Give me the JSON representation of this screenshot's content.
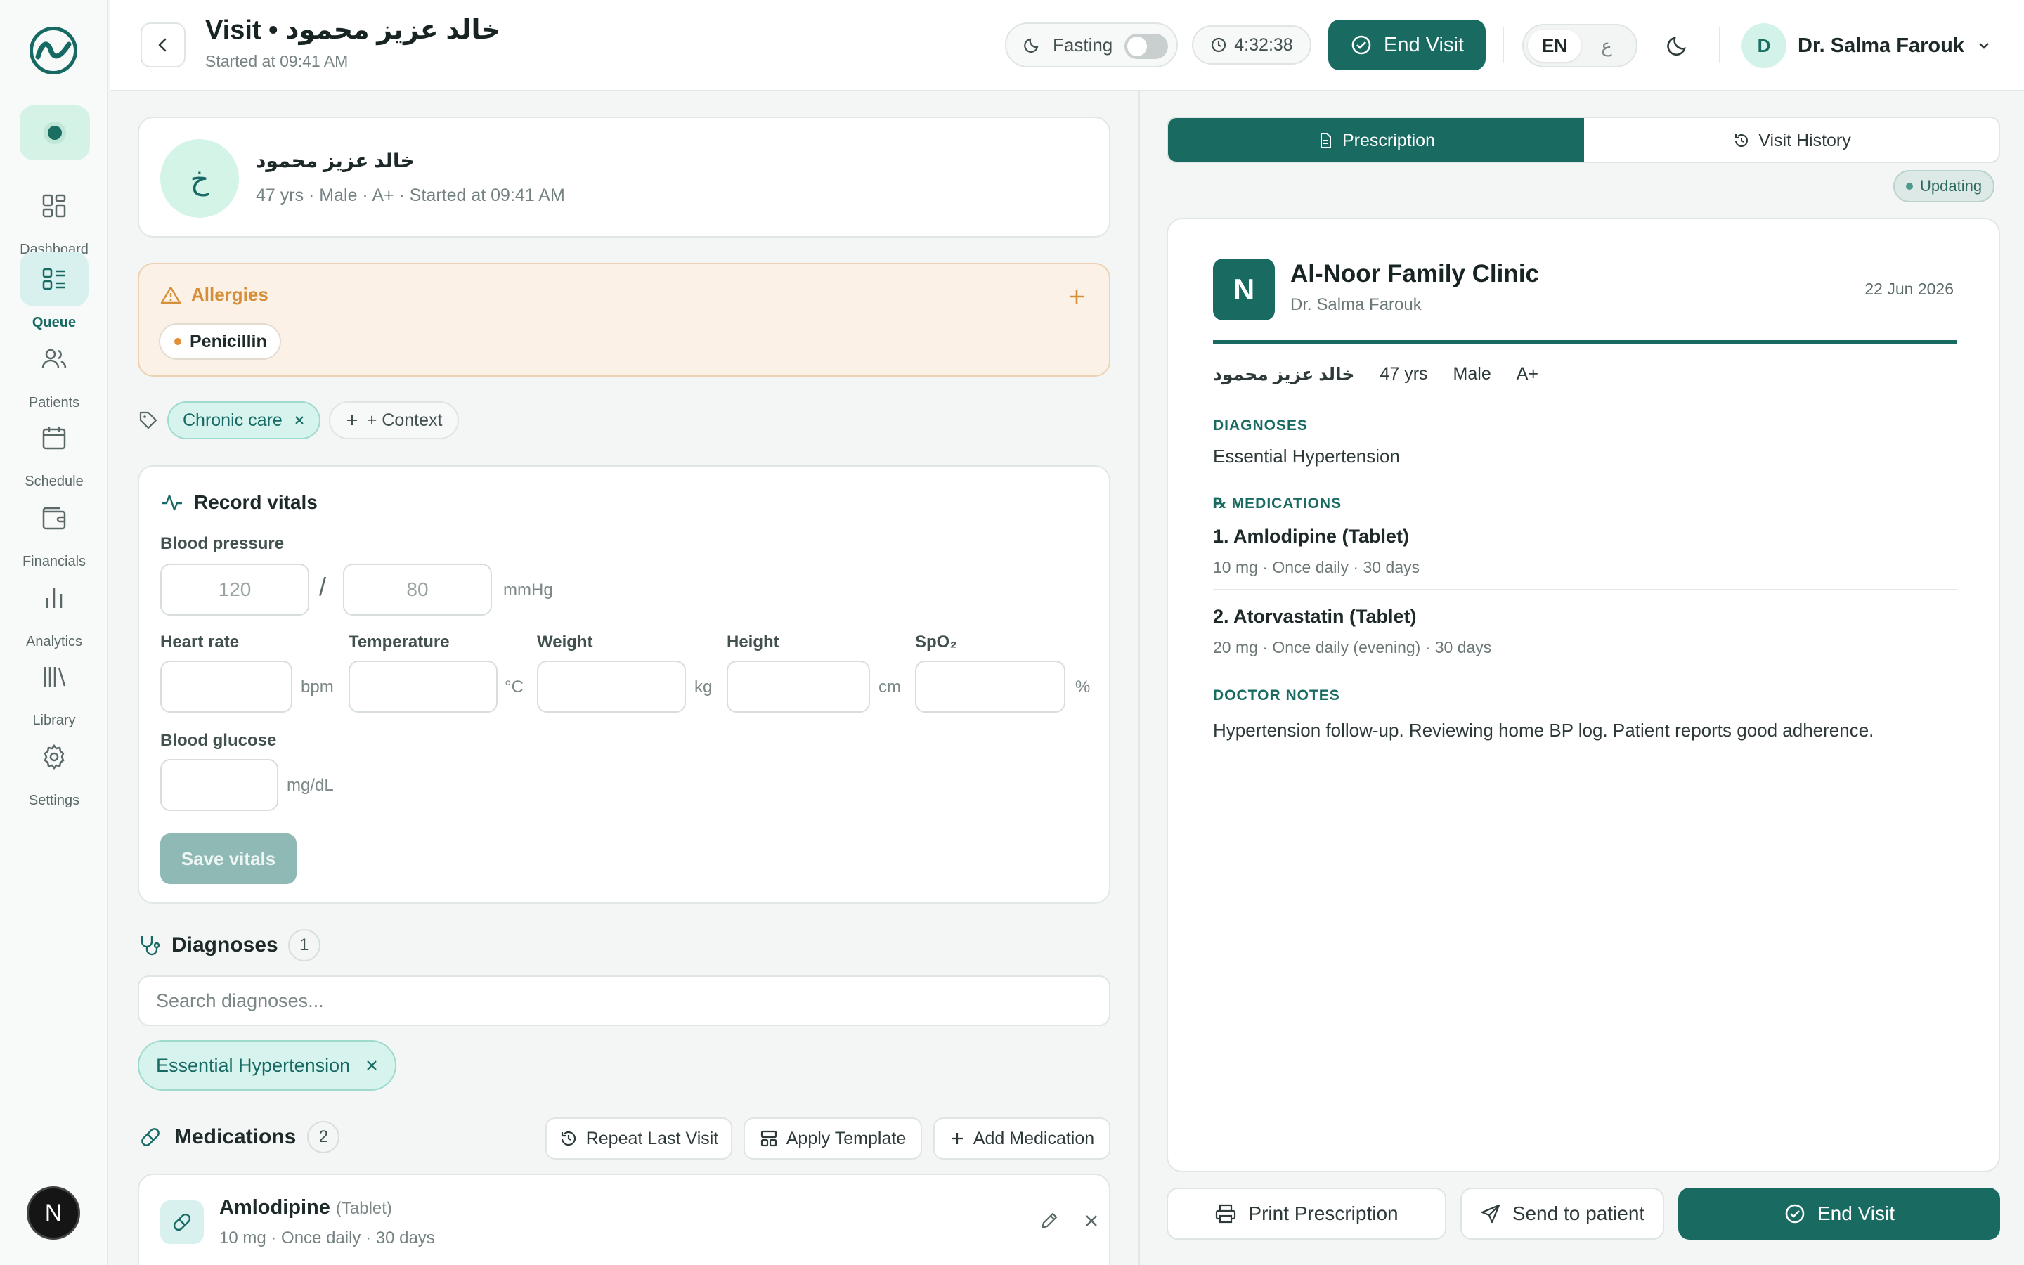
{
  "header": {
    "title": "Visit • خالد عزيز محمود",
    "subtitle": "Started at 09:41 AM",
    "fasting_label": "Fasting",
    "timer": "4:32:38",
    "end_visit_label": "End Visit",
    "lang_en": "EN",
    "lang_ar": "ع",
    "user_initial": "D",
    "user_name": "Dr. Salma Farouk"
  },
  "sidebar": {
    "logo_initial": "N",
    "items": [
      {
        "label": "Dashboard",
        "icon": "grid-icon"
      },
      {
        "label": "Queue",
        "icon": "list-icon",
        "active": true
      },
      {
        "label": "Patients",
        "icon": "users-icon"
      },
      {
        "label": "Schedule",
        "icon": "calendar-icon"
      },
      {
        "label": "Financials",
        "icon": "wallet-icon"
      },
      {
        "label": "Analytics",
        "icon": "bar-chart-icon"
      },
      {
        "label": "Library",
        "icon": "library-icon"
      },
      {
        "label": "Settings",
        "icon": "gear-icon"
      }
    ]
  },
  "patient": {
    "initial": "خ",
    "name": "خالد عزيز محمود",
    "meta": "47 yrs · Male · A+ · Started at 09:41 AM"
  },
  "allergies": {
    "title": "Allergies",
    "items": [
      "Penicillin"
    ]
  },
  "context": {
    "tags": [
      "Chronic care"
    ],
    "add_label": "+ Context"
  },
  "vitals": {
    "title": "Record vitals",
    "bp_label": "Blood pressure",
    "bp_sys_placeholder": "120",
    "bp_dia_placeholder": "80",
    "bp_sep": "/",
    "bp_unit": "mmHg",
    "fields": [
      {
        "label": "Heart rate",
        "unit": "bpm"
      },
      {
        "label": "Temperature",
        "unit": "°C"
      },
      {
        "label": "Weight",
        "unit": "kg"
      },
      {
        "label": "Height",
        "unit": "cm"
      },
      {
        "label": "SpO₂",
        "unit": "%"
      }
    ],
    "glucose_label": "Blood glucose",
    "glucose_unit": "mg/dL",
    "save_label": "Save vitals"
  },
  "diagnoses": {
    "title": "Diagnoses",
    "count": "1",
    "search_placeholder": "Search diagnoses...",
    "items": [
      "Essential Hypertension"
    ]
  },
  "medications": {
    "title": "Medications",
    "count": "2",
    "repeat_label": "Repeat Last Visit",
    "template_label": "Apply Template",
    "add_label": "Add Medication",
    "items": [
      {
        "name": "Amlodipine",
        "form": "(Tablet)",
        "meta": "10 mg · Once daily · 30 days"
      }
    ]
  },
  "prescription": {
    "tab_rx": "Prescription",
    "tab_history": "Visit History",
    "status": "Updating",
    "logo_letter": "N",
    "clinic": "Al-Noor Family Clinic",
    "doctor": "Dr. Salma Farouk",
    "date": "22 Jun 2026",
    "patient_name": "خالد عزيز محمود",
    "patient_age": "47 yrs",
    "patient_sex": "Male",
    "patient_blood": "A+",
    "dx_heading": "DIAGNOSES",
    "dx_text": "Essential Hypertension",
    "med_heading": "℞ MEDICATIONS",
    "meds": [
      {
        "title": "1. Amlodipine (Tablet)",
        "meta": "10 mg · Once daily · 30 days"
      },
      {
        "title": "2. Atorvastatin (Tablet)",
        "meta": "20 mg · Once daily (evening) · 30 days"
      }
    ],
    "notes_heading": "DOCTOR NOTES",
    "notes": "Hypertension follow-up. Reviewing home BP log. Patient reports good adherence.",
    "print_label": "Print Prescription",
    "send_label": "Send to patient",
    "end_label": "End Visit"
  },
  "colors": {
    "primary": "#196b62",
    "accent_light": "#d6f4ed",
    "allergy_bg": "#fbf1e6",
    "allergy_text": "#d58f38"
  }
}
